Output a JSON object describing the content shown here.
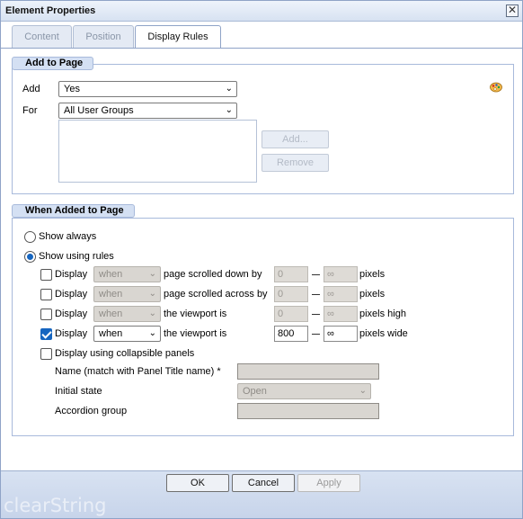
{
  "window": {
    "title": "Element Properties"
  },
  "tabs": [
    {
      "label": "Content",
      "active": false
    },
    {
      "label": "Position",
      "active": false
    },
    {
      "label": "Display Rules",
      "active": true
    }
  ],
  "add_to_page": {
    "legend": "Add to Page",
    "add_label": "Add",
    "add_value": "Yes",
    "for_label": "For",
    "for_value": "All User Groups",
    "add_button": "Add...",
    "remove_button": "Remove"
  },
  "when_added": {
    "legend": "When Added to Page",
    "show_always": "Show always",
    "show_using_rules": "Show using rules",
    "rules": [
      {
        "checked": false,
        "display": "Display",
        "when": "when",
        "condition": "page scrolled down by",
        "from": "0",
        "to": "∞",
        "unit": "pixels",
        "enabled": false
      },
      {
        "checked": false,
        "display": "Display",
        "when": "when",
        "condition": "page scrolled across by",
        "from": "0",
        "to": "∞",
        "unit": "pixels",
        "enabled": false
      },
      {
        "checked": false,
        "display": "Display",
        "when": "when",
        "condition": "the viewport is",
        "from": "0",
        "to": "∞",
        "unit": "pixels high",
        "enabled": false
      },
      {
        "checked": true,
        "display": "Display",
        "when": "when",
        "condition": "the viewport is",
        "from": "800",
        "to": "∞",
        "unit": "pixels wide",
        "enabled": true
      }
    ],
    "collapsible": {
      "label": "Display using collapsible panels",
      "name_label": "Name (match with Panel Title name) *",
      "initial_state_label": "Initial state",
      "initial_state_value": "Open",
      "accordion_label": "Accordion group"
    }
  },
  "footer": {
    "ok": "OK",
    "cancel": "Cancel",
    "apply": "Apply",
    "brand": "clearString"
  },
  "colors": {
    "accent": "#1565c0",
    "legend_bg": "#d4e0f3",
    "footer_bg": "#c7d4ea"
  }
}
